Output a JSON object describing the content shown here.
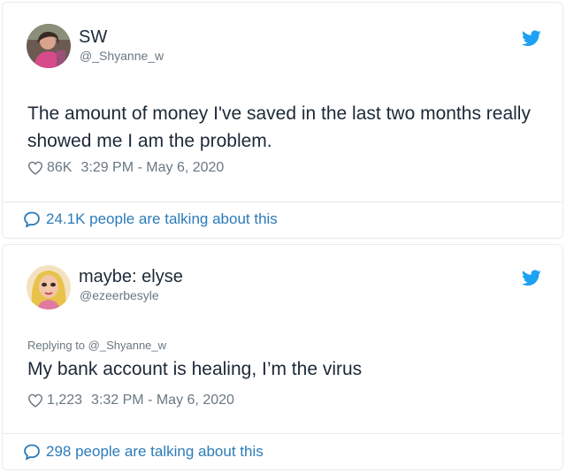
{
  "colors": {
    "text": "#1c2938",
    "muted": "#697882",
    "link": "#2b7bb9",
    "twitter_blue": "#1da1f2",
    "border": "#e6ecf0"
  },
  "tweets": [
    {
      "display_name": "SW",
      "handle": "@_Shyanne_w",
      "reply_context": "",
      "text": "The amount of money I've saved in the last two months really showed me I am the problem.",
      "likes": "86K",
      "timestamp": "3:29 PM - May 6, 2020",
      "talking": "24.1K people are talking about this",
      "icons": {
        "brand": "twitter-bird-icon",
        "like": "heart-icon",
        "conversation": "speech-bubble-icon"
      }
    },
    {
      "display_name": "maybe: elyse",
      "handle": "@ezeerbesyle",
      "reply_context": "Replying to @_Shyanne_w",
      "text": "My bank account is healing, I’m the virus",
      "likes": "1,223",
      "timestamp": "3:32 PM - May 6, 2020",
      "talking": "298 people are talking about this",
      "icons": {
        "brand": "twitter-bird-icon",
        "like": "heart-icon",
        "conversation": "speech-bubble-icon"
      }
    }
  ]
}
